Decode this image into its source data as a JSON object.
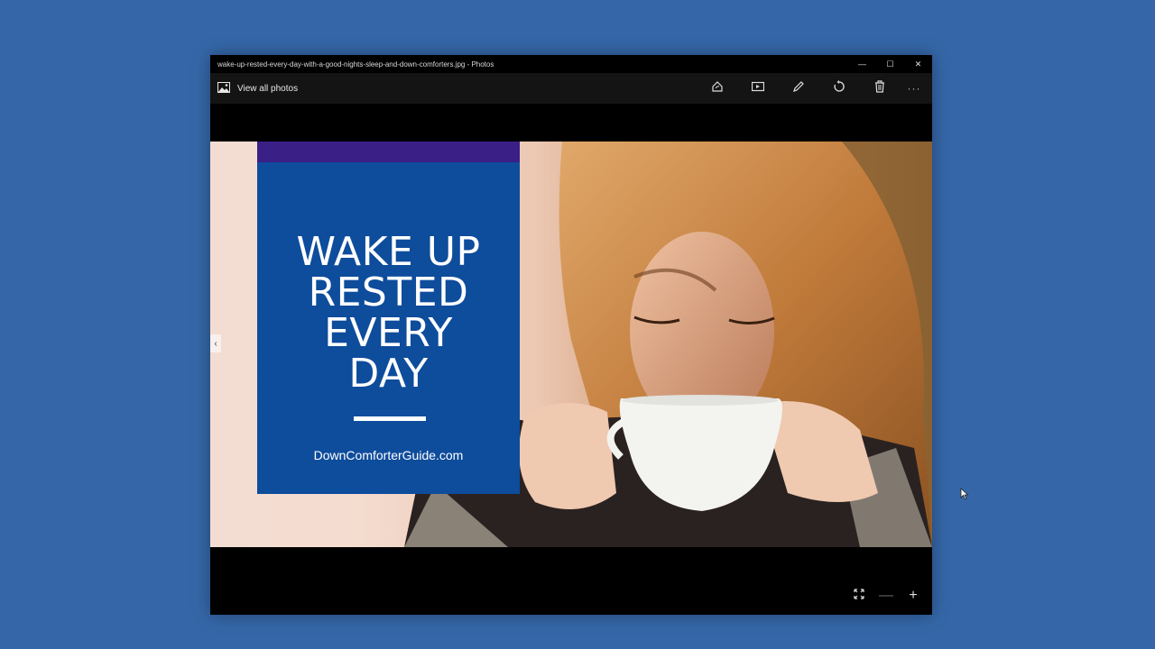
{
  "window": {
    "title": "wake-up-rested-every-day-with-a-good-nights-sleep-and-down-comforters.jpg - Photos",
    "minimize": "—",
    "maximize": "☐",
    "close": "✕"
  },
  "appbar": {
    "view_all_label": "View all photos",
    "more": "···"
  },
  "photo": {
    "headline_line1": "WAKE UP",
    "headline_line2": "RESTED",
    "headline_line3": "EVERY",
    "headline_line4": "DAY",
    "site": "DownComforterGuide.com",
    "prev_arrow": "‹"
  },
  "zoom": {
    "minus": "—",
    "plus": "+"
  },
  "colors": {
    "desktop": "#3567a8",
    "card": "#0e4c9c",
    "card_stripe": "#3a1f86"
  }
}
